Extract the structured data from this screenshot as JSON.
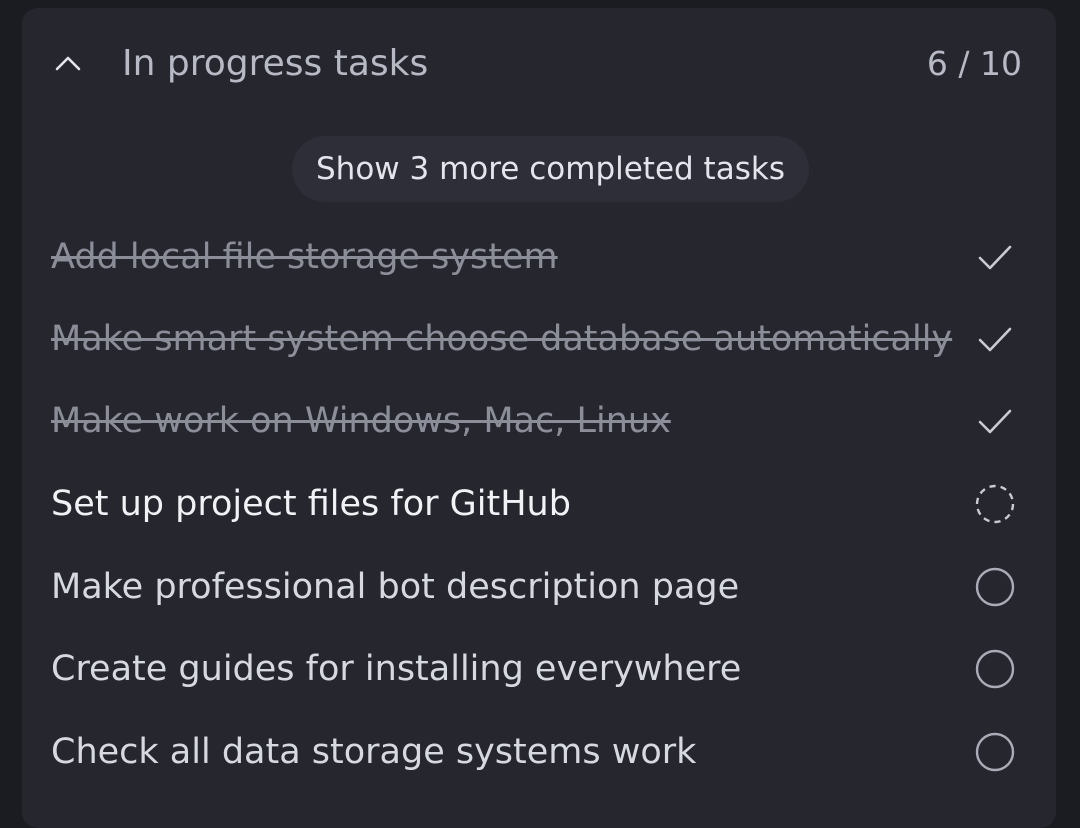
{
  "section": {
    "title": "In progress tasks",
    "count": "6 / 10",
    "show_more_label": "Show 3 more completed tasks",
    "collapse_icon": "chevron-up-icon"
  },
  "tasks": [
    {
      "label": "Add local file storage system",
      "status": "completed",
      "icon": "check-icon"
    },
    {
      "label": "Make smart system choose database automatically",
      "status": "completed",
      "icon": "check-icon"
    },
    {
      "label": "Make work on Windows, Mac, Linux",
      "status": "completed",
      "icon": "check-icon"
    },
    {
      "label": "Set up project files for GitHub",
      "status": "in-progress",
      "icon": "dashed-circle-icon"
    },
    {
      "label": "Make professional bot description page",
      "status": "pending",
      "icon": "empty-circle-icon"
    },
    {
      "label": "Create guides for installing everywhere",
      "status": "pending",
      "icon": "empty-circle-icon"
    },
    {
      "label": "Check all data storage systems work",
      "status": "pending",
      "icon": "empty-circle-icon"
    }
  ],
  "colors": {
    "background": "#1b1c22",
    "panel": "#25262e",
    "pill": "#2d2e37",
    "text_primary": "#f1f2f6",
    "text_muted": "#8b8d98",
    "icon": "#a9abb6"
  }
}
